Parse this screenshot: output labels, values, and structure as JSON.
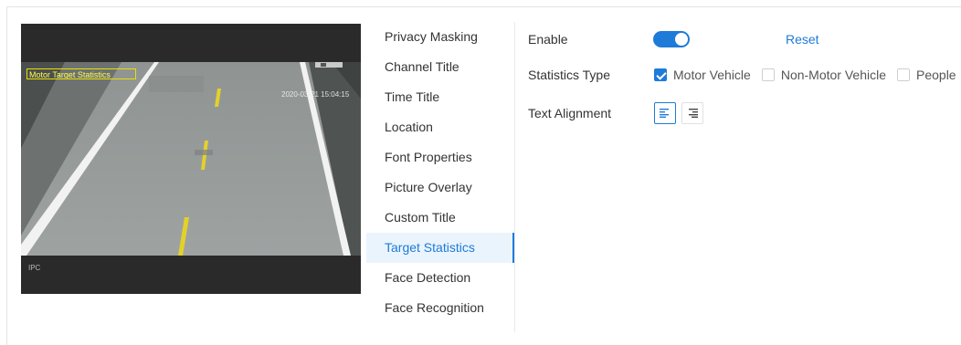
{
  "preview": {
    "osd_title": "Motor Target Statistics",
    "osd_time": "2020-03-21 15:04:15",
    "osd_ipc": "IPC"
  },
  "menu": {
    "items": [
      {
        "label": "Privacy Masking",
        "active": false
      },
      {
        "label": "Channel Title",
        "active": false
      },
      {
        "label": "Time Title",
        "active": false
      },
      {
        "label": "Location",
        "active": false
      },
      {
        "label": "Font Properties",
        "active": false
      },
      {
        "label": "Picture Overlay",
        "active": false
      },
      {
        "label": "Custom Title",
        "active": false
      },
      {
        "label": "Target Statistics",
        "active": true
      },
      {
        "label": "Face Detection",
        "active": false
      },
      {
        "label": "Face Recognition",
        "active": false
      }
    ]
  },
  "form": {
    "enable_label": "Enable",
    "enable_on": true,
    "reset_label": "Reset",
    "stats_type_label": "Statistics Type",
    "stats_types": [
      {
        "label": "Motor Vehicle",
        "checked": true
      },
      {
        "label": "Non-Motor Vehicle",
        "checked": false
      },
      {
        "label": "People",
        "checked": false
      }
    ],
    "text_alignment_label": "Text Alignment",
    "alignment_options": [
      {
        "icon": "align-left-icon",
        "active": true
      },
      {
        "icon": "align-right-icon",
        "active": false
      }
    ]
  },
  "colors": {
    "accent": "#1e7bd8",
    "osd_box": "#e8e000",
    "menu_active_bg": "#eaf4fd"
  }
}
